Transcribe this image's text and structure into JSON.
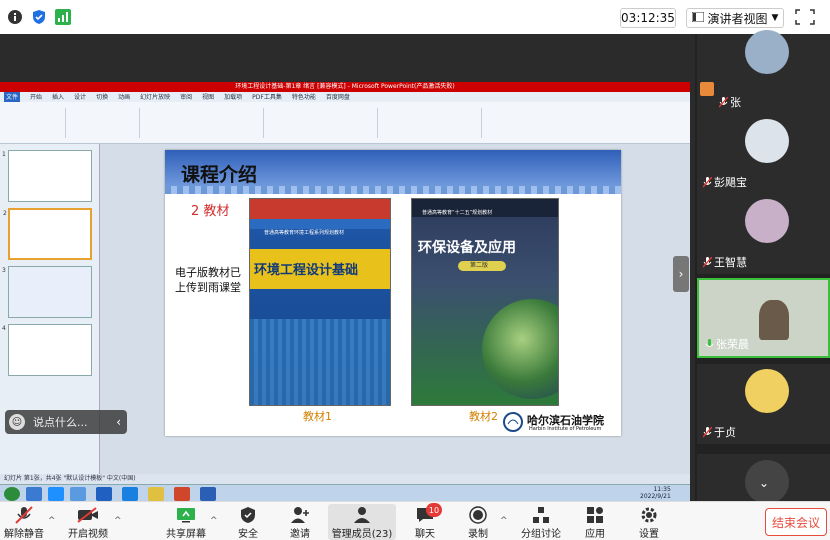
{
  "top": {
    "timer": "03:12:35",
    "view_label": "演讲者视图"
  },
  "ppt": {
    "window_title": "环境工程设计基础-第1章 绪言 [兼容模式] - Microsoft PowerPoint(产品激活失败)",
    "tabs": [
      "文件",
      "开始",
      "插入",
      "设计",
      "切换",
      "动画",
      "幻灯片放映",
      "审阅",
      "视图",
      "加载项",
      "PDF工具集",
      "特色功能",
      "百度网盘"
    ],
    "status": "幻灯片 第1张，共4张  \"默认设计模板\"  中文(中国)",
    "clock_time": "11:35",
    "clock_date": "2022/9/21"
  },
  "slide": {
    "title": "课程介绍",
    "subtitle": "2 教材",
    "note": "电子版教材已上传到雨课堂",
    "book1_series": "普通高等教育环境工程系列规划教材",
    "book1_title": "环境工程设计基础",
    "book2_series": "普通高等教育“十二五”规划教材",
    "book2_title": "环保设备及应用",
    "book2_edition": "第二版",
    "caption1": "教材1",
    "caption2": "教材2",
    "school_cn": "哈尔滨石油学院",
    "school_en": "Harbin Institute of Petroleum"
  },
  "comment": {
    "placeholder": "说点什么..."
  },
  "participants": [
    {
      "name": "张",
      "muted": true
    },
    {
      "name": "彭飓宝",
      "muted": true
    },
    {
      "name": "王智慧",
      "muted": true
    },
    {
      "name": "张荣晨",
      "muted": false
    },
    {
      "name": "于贞",
      "muted": true
    }
  ],
  "bottom": {
    "unmute": "解除静音",
    "video": "开启视频",
    "share": "共享屏幕",
    "security": "安全",
    "invite": "邀请",
    "members": "管理成员(23)",
    "chat": "聊天",
    "chat_badge": "10",
    "record": "录制",
    "breakout": "分组讨论",
    "apps": "应用",
    "settings": "设置",
    "end": "结束会议"
  },
  "colors": {
    "accent": "#3bc03b",
    "end": "#e74c3c",
    "slide_title_band": "#2f5fb8"
  }
}
